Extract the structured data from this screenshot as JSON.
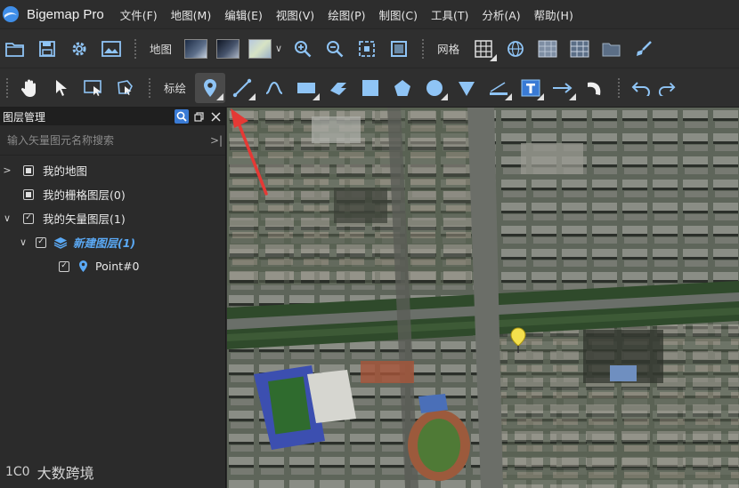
{
  "app": {
    "title": "Bigemap Pro"
  },
  "menu": [
    "文件(F)",
    "地图(M)",
    "编辑(E)",
    "视图(V)",
    "绘图(P)",
    "制图(C)",
    "工具(T)",
    "分析(A)",
    "帮助(H)"
  ],
  "toolbar1": {
    "map_label": "地图",
    "grid_label": "网格"
  },
  "toolbar2": {
    "annotate_label": "标绘"
  },
  "layer_panel": {
    "title": "图层管理",
    "search_placeholder": "输入矢量图元名称搜索",
    "items": [
      {
        "label": "我的地图"
      },
      {
        "label": "我的栅格图层(0)"
      },
      {
        "label": "我的矢量图层(1)"
      },
      {
        "label": "新建图层(1)"
      },
      {
        "label": "Point#0"
      }
    ]
  },
  "watermark": {
    "text": "大数跨境",
    "logo": "1C0"
  },
  "colors": {
    "accent": "#3a7bd5",
    "new_layer": "#5aa9f5",
    "marker": "#f4e04d",
    "arrow": "#e53935"
  }
}
